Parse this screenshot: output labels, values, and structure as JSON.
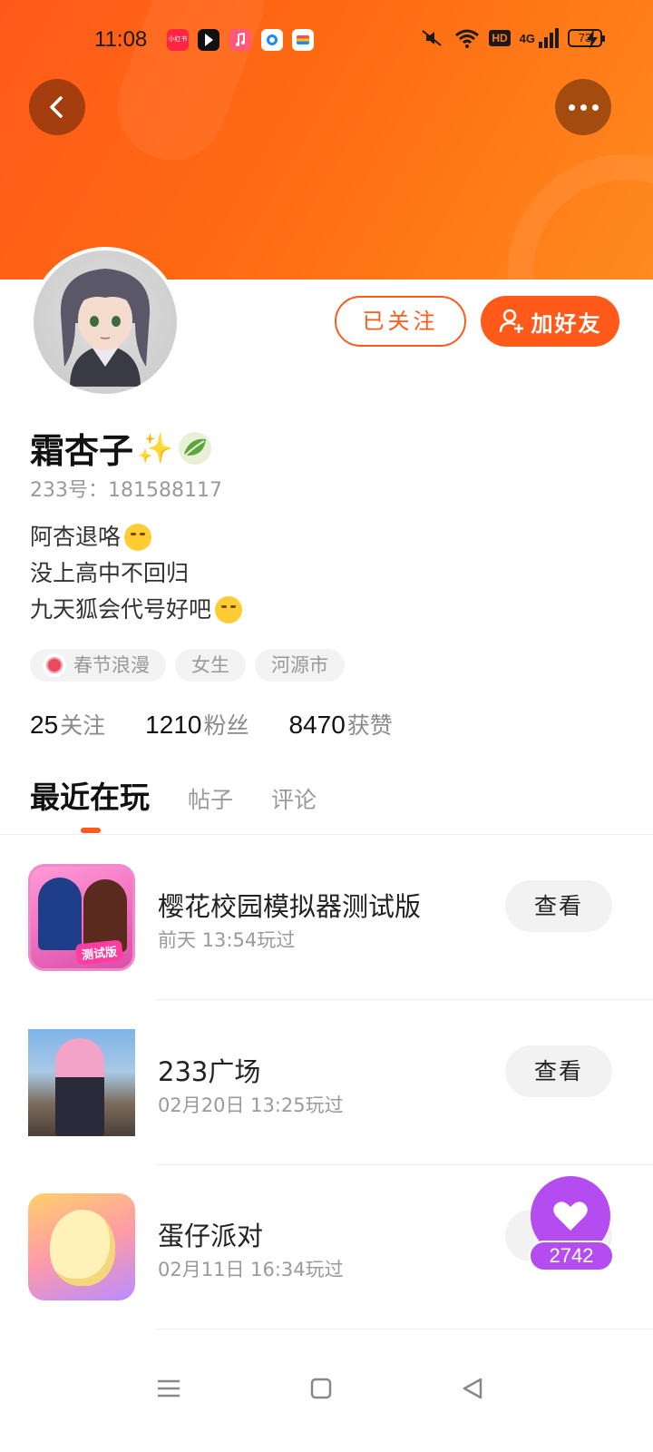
{
  "status_bar": {
    "time": "11:08",
    "apps": [
      "小红书",
      "",
      "",
      "",
      ""
    ],
    "hd": "HD",
    "network": "4G",
    "battery": "73"
  },
  "profile": {
    "username": "霜杏子",
    "uid_label": "233号：",
    "uid_value": "181588117",
    "follow_label": "已关注",
    "add_friend_label": "加好友",
    "bio": [
      "阿杏退咯",
      "没上高中不回归",
      "九天狐会代号好吧"
    ],
    "tags": [
      "春节浪漫",
      "女生",
      "河源市"
    ],
    "stats": [
      {
        "num": "25",
        "label": "关注"
      },
      {
        "num": "1210",
        "label": "粉丝"
      },
      {
        "num": "8470",
        "label": "获赞"
      }
    ]
  },
  "tabs": [
    "最近在玩",
    "帖子",
    "评论"
  ],
  "games": [
    {
      "name": "樱花校园模拟器测试版",
      "time": "前天 13:54玩过",
      "button": "查看",
      "badge": "测试版"
    },
    {
      "name": "233广场",
      "time": "02月20日 13:25玩过",
      "button": "查看"
    },
    {
      "name": "蛋仔派对",
      "time": "02月11日 16:34玩过",
      "button": "查看"
    }
  ],
  "like_count": "2742",
  "colors": {
    "accent": "#ff5a1a",
    "like": "#b44cf0"
  }
}
